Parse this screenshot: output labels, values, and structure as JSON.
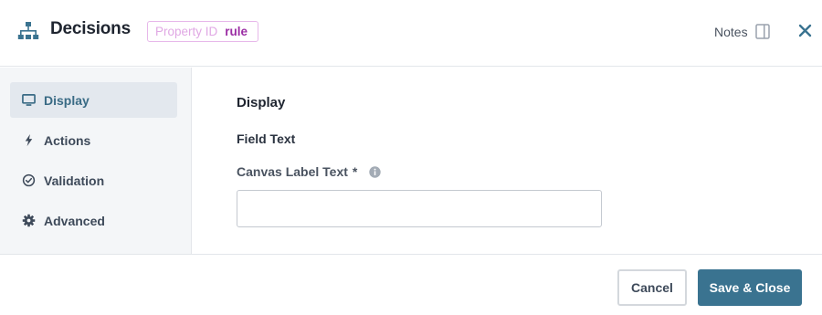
{
  "header": {
    "icon": "sitemap-icon",
    "title": "Decisions",
    "property_id_label": "Property ID",
    "property_id_value": "rule",
    "notes_label": "Notes",
    "notes_icon": "panel-icon",
    "close_icon": "close-icon"
  },
  "sidebar": {
    "items": [
      {
        "label": "Display",
        "icon": "monitor-icon",
        "active": true
      },
      {
        "label": "Actions",
        "icon": "lightning-icon",
        "active": false
      },
      {
        "label": "Validation",
        "icon": "check-circle-icon",
        "active": false
      },
      {
        "label": "Advanced",
        "icon": "gear-icon",
        "active": false
      }
    ]
  },
  "main": {
    "section_title": "Display",
    "subsection_title": "Field Text",
    "canvas_label": {
      "label": "Canvas Label Text",
      "required_marker": "*",
      "info_icon": "info-icon",
      "value": "",
      "placeholder": ""
    }
  },
  "footer": {
    "cancel_label": "Cancel",
    "save_label": "Save & Close"
  },
  "colors": {
    "accent": "#3a7390",
    "active_nav_text": "#3a6b85",
    "badge_border": "#e7b8ea",
    "badge_value": "#9b2ea4"
  }
}
